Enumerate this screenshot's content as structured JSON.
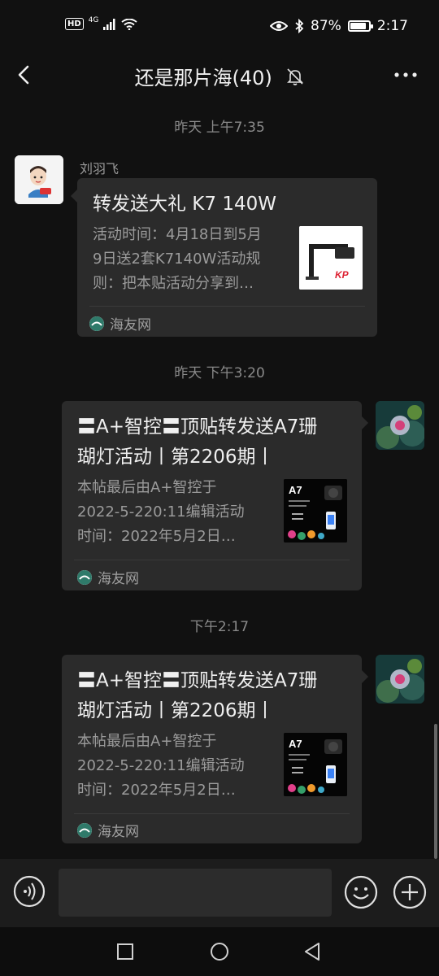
{
  "status_bar": {
    "network_badge": "HD",
    "network_type": "4G",
    "battery_percent": "87%",
    "battery_level": 0.87,
    "time": "2:17"
  },
  "header": {
    "title": "还是那片海(40)"
  },
  "messages": [
    {
      "timestamp": "昨天 上午7:35",
      "sender": "刘羽飞",
      "card": {
        "title": "转发送大礼 K7 140W",
        "desc": [
          "活动时间：4月18日到5月",
          "9日送2套K7140W活动规",
          "则：把本贴活动分享到…"
        ],
        "source": "海友网",
        "thumb_caption": "KP"
      }
    },
    {
      "timestamp": "昨天 下午3:20",
      "card": {
        "title": [
          "〓A+智控〓顶贴转发送A7珊",
          "瑚灯活动丨第2206期丨"
        ],
        "desc": [
          "本帖最后由A+智控于",
          "2022-5-220:11编辑活动",
          "时间：2022年5月2日…"
        ],
        "source": "海友网",
        "thumb_caption": "A7"
      }
    },
    {
      "timestamp": "下午2:17",
      "card": {
        "title": [
          "〓A+智控〓顶贴转发送A7珊",
          "瑚灯活动丨第2206期丨"
        ],
        "desc": [
          "本帖最后由A+智控于",
          "2022-5-220:11编辑活动",
          "时间：2022年5月2日…"
        ],
        "source": "海友网",
        "thumb_caption": "A7"
      }
    }
  ],
  "input": {
    "placeholder": ""
  },
  "colors": {
    "background": "#111111",
    "bubble": "#2b2b2b",
    "timestamp_text": "#8a8a8a"
  },
  "icons": {
    "back": "chevron-left-icon",
    "mute": "bell-off-icon",
    "more": "more-dots-icon",
    "voice": "voice-icon",
    "emoji": "smiley-icon",
    "plus": "plus-circle-icon"
  }
}
